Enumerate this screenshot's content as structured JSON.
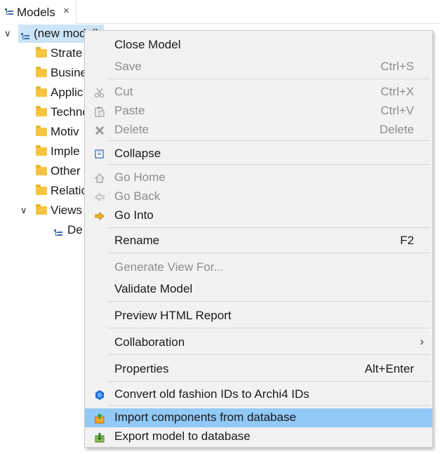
{
  "tab": {
    "title": "Models",
    "close": "×"
  },
  "tree": {
    "root": "(new model)",
    "folders": [
      "Strate",
      "Busine",
      "Applic",
      "Techno",
      "Motiv",
      "Imple",
      "Other",
      "Relatio",
      "Views"
    ],
    "view_item": "De"
  },
  "menu": {
    "close_model": "Close Model",
    "save": "Save",
    "save_key": "Ctrl+S",
    "cut": "Cut",
    "cut_key": "Ctrl+X",
    "paste": "Paste",
    "paste_key": "Ctrl+V",
    "delete": "Delete",
    "delete_key": "Delete",
    "collapse": "Collapse",
    "go_home": "Go Home",
    "go_back": "Go Back",
    "go_into": "Go Into",
    "rename": "Rename",
    "rename_key": "F2",
    "generate_view": "Generate View For...",
    "validate": "Validate Model",
    "preview_html": "Preview HTML Report",
    "collaboration": "Collaboration",
    "collab_arrow": "›",
    "properties": "Properties",
    "properties_key": "Alt+Enter",
    "convert_ids": "Convert old fashion IDs to Archi4 IDs",
    "import_db": "Import components from database",
    "export_db": "Export model to database"
  },
  "colors": {
    "selection": "#cce4f7",
    "menu_highlight": "#91c9f7",
    "folder": "#f5c542"
  }
}
